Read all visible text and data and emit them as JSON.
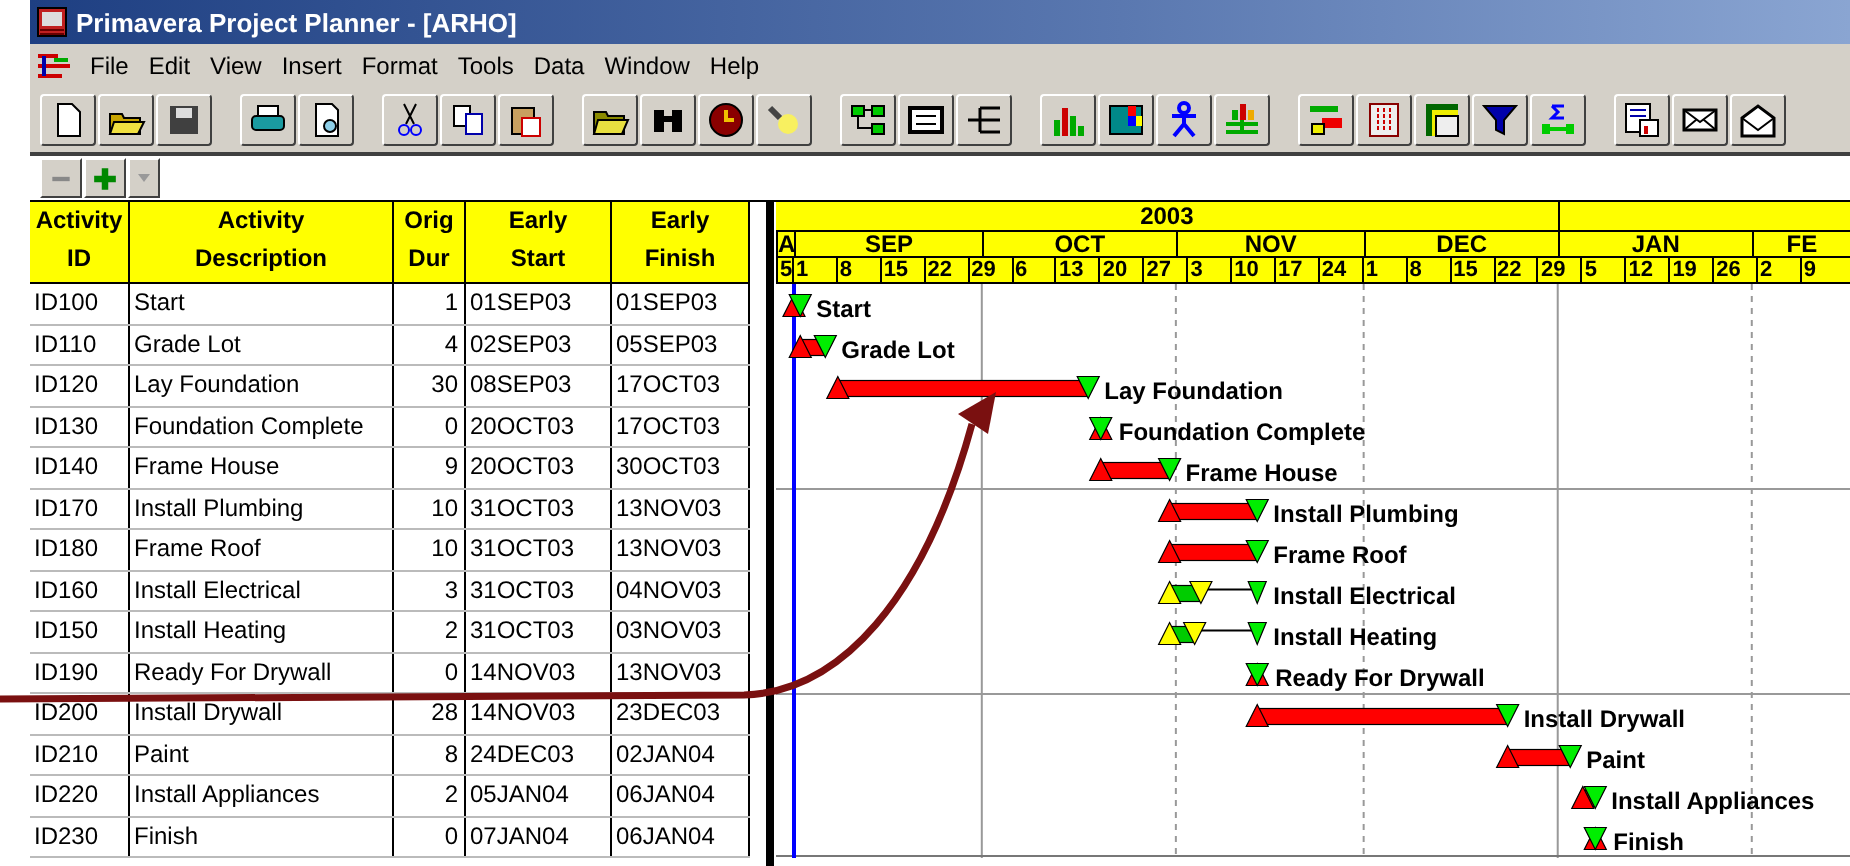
{
  "window": {
    "title": "Primavera Project Planner - [ARHO]"
  },
  "menu": [
    "File",
    "Edit",
    "View",
    "Insert",
    "Format",
    "Tools",
    "Data",
    "Window",
    "Help"
  ],
  "table": {
    "columns": [
      {
        "line1": "Activity",
        "line2": "ID"
      },
      {
        "line1": "Activity",
        "line2": "Description"
      },
      {
        "line1": "Orig",
        "line2": "Dur"
      },
      {
        "line1": "Early",
        "line2": "Start"
      },
      {
        "line1": "Early",
        "line2": "Finish"
      }
    ],
    "rows": [
      {
        "id": "ID100",
        "description": "Start",
        "dur": "1",
        "start": "01SEP03",
        "finish": "01SEP03",
        "kind": "critical",
        "bar_label": "Start"
      },
      {
        "id": "ID110",
        "description": "Grade Lot",
        "dur": "4",
        "start": "02SEP03",
        "finish": "05SEP03",
        "kind": "critical",
        "bar_label": "Grade Lot"
      },
      {
        "id": "ID120",
        "description": "Lay Foundation",
        "dur": "30",
        "start": "08SEP03",
        "finish": "17OCT03",
        "kind": "critical",
        "bar_label": "Lay Foundation"
      },
      {
        "id": "ID130",
        "description": "Foundation Complete",
        "dur": "0",
        "start": "20OCT03",
        "finish": "17OCT03",
        "kind": "milestone",
        "bar_label": "Foundation Complete"
      },
      {
        "id": "ID140",
        "description": "Frame House",
        "dur": "9",
        "start": "20OCT03",
        "finish": "30OCT03",
        "kind": "critical",
        "bar_label": "Frame House"
      },
      {
        "id": "ID170",
        "description": "Install Plumbing",
        "dur": "10",
        "start": "31OCT03",
        "finish": "13NOV03",
        "kind": "critical",
        "bar_label": "Install Plumbing"
      },
      {
        "id": "ID180",
        "description": "Frame Roof",
        "dur": "10",
        "start": "31OCT03",
        "finish": "13NOV03",
        "kind": "critical",
        "bar_label": "Frame Roof"
      },
      {
        "id": "ID160",
        "description": "Install Electrical",
        "dur": "3",
        "start": "31OCT03",
        "finish": "04NOV03",
        "kind": "noncritical",
        "bar_label": "Install Electrical"
      },
      {
        "id": "ID150",
        "description": "Install Heating",
        "dur": "2",
        "start": "31OCT03",
        "finish": "03NOV03",
        "kind": "noncritical",
        "bar_label": "Install Heating"
      },
      {
        "id": "ID190",
        "description": "Ready For Drywall",
        "dur": "0",
        "start": "14NOV03",
        "finish": "13NOV03",
        "kind": "milestone",
        "bar_label": "Ready For Drywall"
      },
      {
        "id": "ID200",
        "description": "Install Drywall",
        "dur": "28",
        "start": "14NOV03",
        "finish": "23DEC03",
        "kind": "critical",
        "bar_label": "Install Drywall"
      },
      {
        "id": "ID210",
        "description": "Paint",
        "dur": "8",
        "start": "24DEC03",
        "finish": "02JAN04",
        "kind": "critical",
        "bar_label": "Paint"
      },
      {
        "id": "ID220",
        "description": "Install Appliances",
        "dur": "2",
        "start": "05JAN04",
        "finish": "06JAN04",
        "kind": "critical",
        "bar_label": "Install Appliances"
      },
      {
        "id": "ID230",
        "description": "Finish",
        "dur": "0",
        "start": "07JAN04",
        "finish": "06JAN04",
        "kind": "milestone",
        "bar_label": "Finish"
      }
    ]
  },
  "timescale": {
    "year": "2003",
    "months": [
      "A",
      "SEP",
      "OCT",
      "NOV",
      "DEC",
      "JAN",
      "FE"
    ],
    "weeks": [
      "5",
      "1",
      "8",
      "15",
      "22",
      "29",
      "6",
      "13",
      "20",
      "27",
      "3",
      "10",
      "17",
      "24",
      "1",
      "8",
      "15",
      "22",
      "29",
      "5",
      "12",
      "19",
      "26",
      "2",
      "9"
    ]
  }
}
